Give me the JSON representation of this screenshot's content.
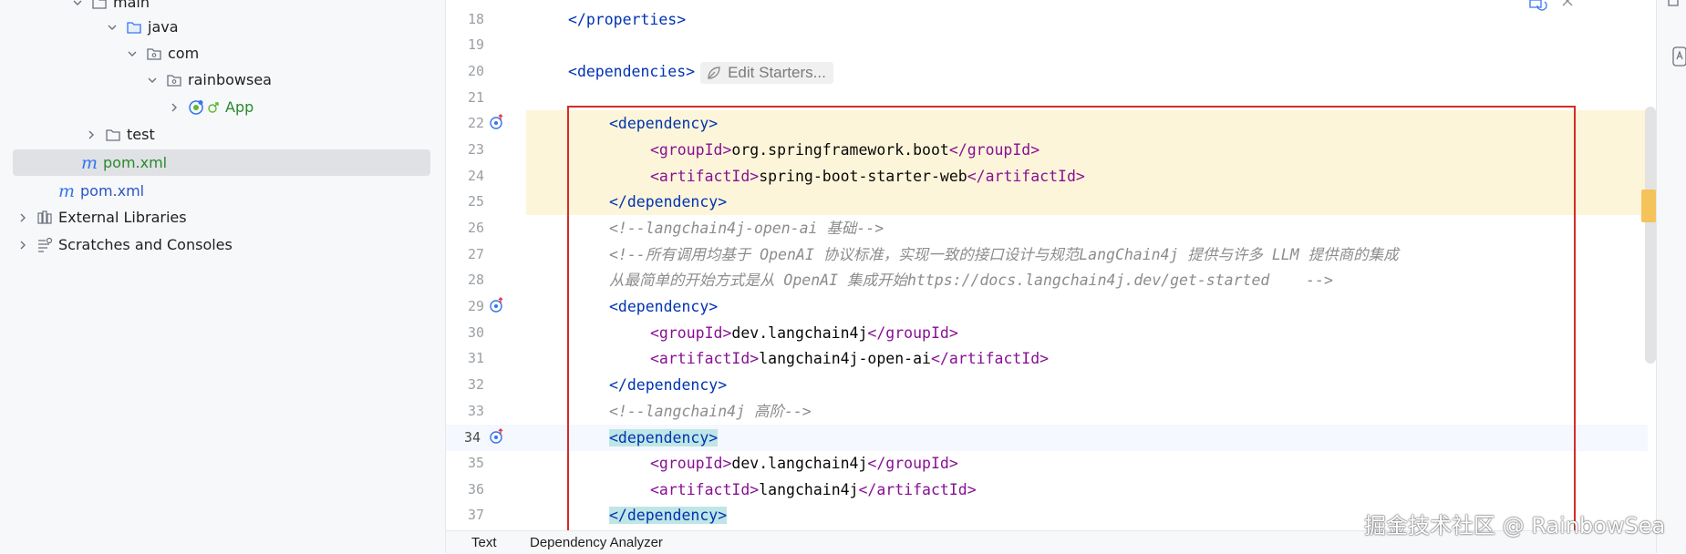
{
  "tree": {
    "items": [
      {
        "label": "main",
        "kind": "folder"
      },
      {
        "label": "java",
        "kind": "folder"
      },
      {
        "label": "com",
        "kind": "package"
      },
      {
        "label": "rainbowsea",
        "kind": "package"
      },
      {
        "label": "App",
        "kind": "spring-app"
      },
      {
        "label": "test",
        "kind": "folder"
      },
      {
        "label": "pom.xml",
        "kind": "maven-file"
      },
      {
        "label": "pom.xml",
        "kind": "maven-file"
      },
      {
        "label": "External Libraries",
        "kind": "libraries"
      },
      {
        "label": "Scratches and Consoles",
        "kind": "scratches"
      }
    ]
  },
  "editor": {
    "line_numbers": [
      "18",
      "19",
      "20",
      "21",
      "22",
      "23",
      "24",
      "25",
      "26",
      "27",
      "28",
      "29",
      "30",
      "31",
      "32",
      "33",
      "34",
      "35",
      "36",
      "37"
    ],
    "current_line": "34",
    "hint_label": "Edit Starters...",
    "code": {
      "l18": "</properties>",
      "l20_open": "<",
      "l20_tag": "dependencies",
      "l20_close": ">",
      "dep_open": "<dependency>",
      "dep_close": "</dependency>",
      "gid_open": "<groupId>",
      "gid_close": "</groupId>",
      "aid_open": "<artifactId>",
      "aid_close": "</artifactId>",
      "l23_val": "org.springframework.boot",
      "l24_val": "spring-boot-starter-web",
      "l26": "<!--langchain4j-open-ai 基础-->",
      "l27": "<!--所有调用均基于 OpenAI 协议标准，实现一致的接口设计与规范LangChain4j 提供与许多 LLM 提供商的集成",
      "l28_text": "从最简单的开始方式是从 OpenAI 集成开始",
      "l28_link": "https://docs.langchain4j.dev/get-started",
      "l28_end": "    -->",
      "l30_val": "dev.langchain4j",
      "l31_val": "langchain4j-open-ai",
      "l33": "<!--langchain4j 高阶-->",
      "l35_val": "dev.langchain4j",
      "l36_val": "langchain4j"
    }
  },
  "bottom_tabs": [
    "Text",
    "Dependency Analyzer"
  ],
  "watermark": "掘金技术社区 @ RainbowSea",
  "colors": {
    "tag": "#0033b3",
    "subtag": "#871094",
    "comment": "#8c8c8c",
    "highlight_band": "#fdf5d9",
    "annotation_box": "#d62b2b"
  }
}
